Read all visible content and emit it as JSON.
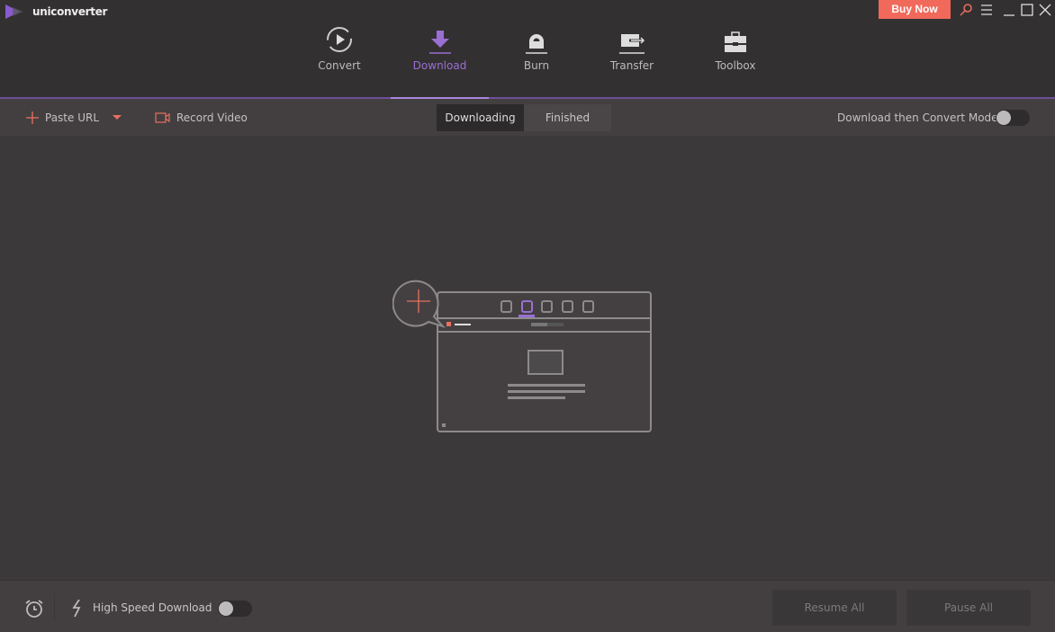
{
  "app": {
    "title": "uniconverter",
    "buy_now": "Buy Now"
  },
  "nav": [
    {
      "label": "Convert",
      "icon": "convert-icon"
    },
    {
      "label": "Download",
      "icon": "download-icon",
      "active": true
    },
    {
      "label": "Burn",
      "icon": "burn-icon"
    },
    {
      "label": "Transfer",
      "icon": "transfer-icon"
    },
    {
      "label": "Toolbox",
      "icon": "toolbox-icon"
    }
  ],
  "toolbar": {
    "paste_url": "Paste URL",
    "record_video": "Record Video",
    "tabs": [
      "Downloading",
      "Finished"
    ],
    "active_tab": "Downloading",
    "convert_mode_label": "Download then Convert Mode",
    "convert_mode_on": false
  },
  "footer": {
    "high_speed_label": "High Speed Download",
    "high_speed_on": false,
    "resume_all": "Resume All",
    "pause_all": "Pause All"
  },
  "colors": {
    "accent": "#9a6fd3",
    "buy": "#f0695a",
    "plus": "#e8705e"
  }
}
